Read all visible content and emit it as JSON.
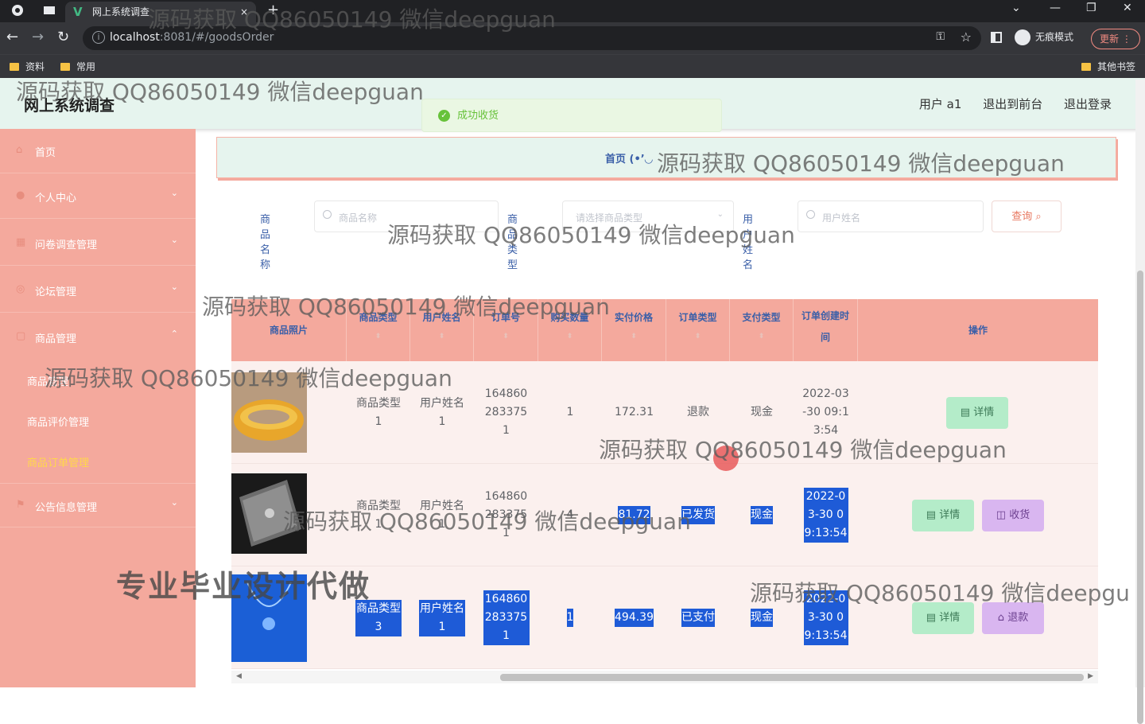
{
  "browser": {
    "tab_title": "网上系统调查",
    "tab_close": "×",
    "new_tab": "+",
    "url_host": "localhost",
    "url_rest": ":8081/#/goodsOrder",
    "incognito_label": "无痕模式",
    "update_label": "更新",
    "bookmarks": [
      "资料",
      "常用"
    ],
    "other_bookmarks": "其他书签"
  },
  "header": {
    "title": "网上系统调查",
    "user": "用户 a1",
    "back_front": "退出到前台",
    "logout": "退出登录"
  },
  "toast": {
    "message": "成功收货"
  },
  "sidebar": {
    "items": [
      {
        "label": "首页",
        "icon": "home-icon"
      },
      {
        "label": "个人中心",
        "icon": "user-icon"
      },
      {
        "label": "问卷调查管理",
        "icon": "survey-icon"
      },
      {
        "label": "论坛管理",
        "icon": "forum-icon"
      },
      {
        "label": "商品管理",
        "icon": "goods-icon"
      }
    ],
    "sub_items": [
      "商品管理",
      "商品评价管理",
      "商品订单管理"
    ],
    "last_item": {
      "label": "公告信息管理",
      "icon": "flag-icon"
    }
  },
  "breadcrumb": {
    "home": "首页"
  },
  "search": {
    "name_label": "商品名称",
    "name_placeholder": "商品名称",
    "type_label": "商品类型",
    "type_placeholder": "请选择商品类型",
    "user_label": "用户姓名",
    "user_placeholder": "用户姓名",
    "query_button": "查询"
  },
  "table": {
    "headers": [
      "商品照片",
      "商品类型",
      "用户姓名",
      "订单号",
      "购买数量",
      "实付价格",
      "订单类型",
      "支付类型",
      "订单创建时间",
      "操作"
    ],
    "rows": [
      {
        "type": "商品类型1",
        "user": "用户姓名1",
        "order_no": "1648602833751",
        "qty": "1",
        "price": "172.31",
        "order_type": "退款",
        "pay_type": "现金",
        "created": "2022-03-30 09:13:54",
        "actions": [
          "详情"
        ]
      },
      {
        "type": "商品类型1",
        "user": "用户姓名1",
        "order_no": "1648602833751",
        "qty": "4",
        "price": "81.72",
        "order_type": "已发货",
        "pay_type": "现金",
        "created": "2022-03-30 09:13:54",
        "actions": [
          "详情",
          "收货"
        ]
      },
      {
        "type": "商品类型3",
        "user": "用户姓名1",
        "order_no": "1648602833751",
        "qty": "1",
        "price": "494.39",
        "order_type": "已支付",
        "pay_type": "现金",
        "created": "2022-03-30 09:13:54",
        "actions": [
          "详情",
          "退款"
        ]
      }
    ]
  },
  "watermarks": {
    "text": "源码获取 QQ86050149 微信deepguan",
    "text_cut": "源码获取 QQ86050149 微信deepgu",
    "big": "专业毕业设计代做"
  }
}
